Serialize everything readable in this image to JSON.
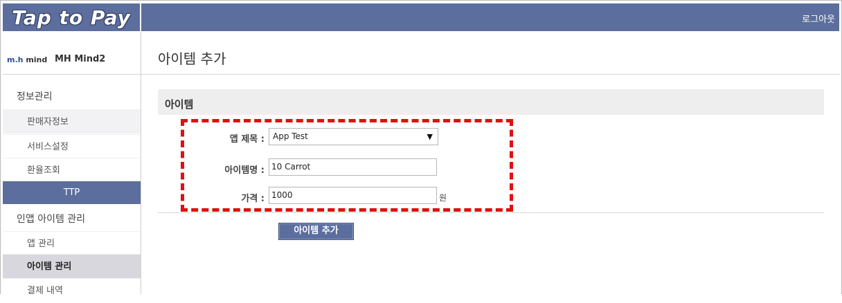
{
  "header": {
    "logo": "Tap to Pay",
    "logout": "로그아웃"
  },
  "profile": {
    "logo_text_a": "m.h",
    "logo_text_b": "mind",
    "name": "MH Mind2"
  },
  "sidebar": {
    "section1": "정보관리",
    "items1": [
      "판매자정보",
      "서비스설정",
      "환율조회"
    ],
    "ttp": "TTP",
    "section2": "인앱 아이템 관리",
    "items2": [
      "앱 관리",
      "아이템 관리",
      "결제 내역"
    ]
  },
  "main": {
    "page_title": "아이템 추가",
    "section_title": "아이템",
    "fields": {
      "app_label": "앱 제목 :",
      "app_value": "App Test",
      "item_label": "아이템명 :",
      "item_value": "10 Carrot",
      "price_label": "가격 :",
      "price_value": "1000",
      "price_unit": "원"
    },
    "submit_label": "아이템 추가"
  },
  "colors": {
    "brand": "#5b6e9e",
    "highlight": "#e01010"
  },
  "icons": {
    "dropdown": "chevron-down-icon"
  }
}
